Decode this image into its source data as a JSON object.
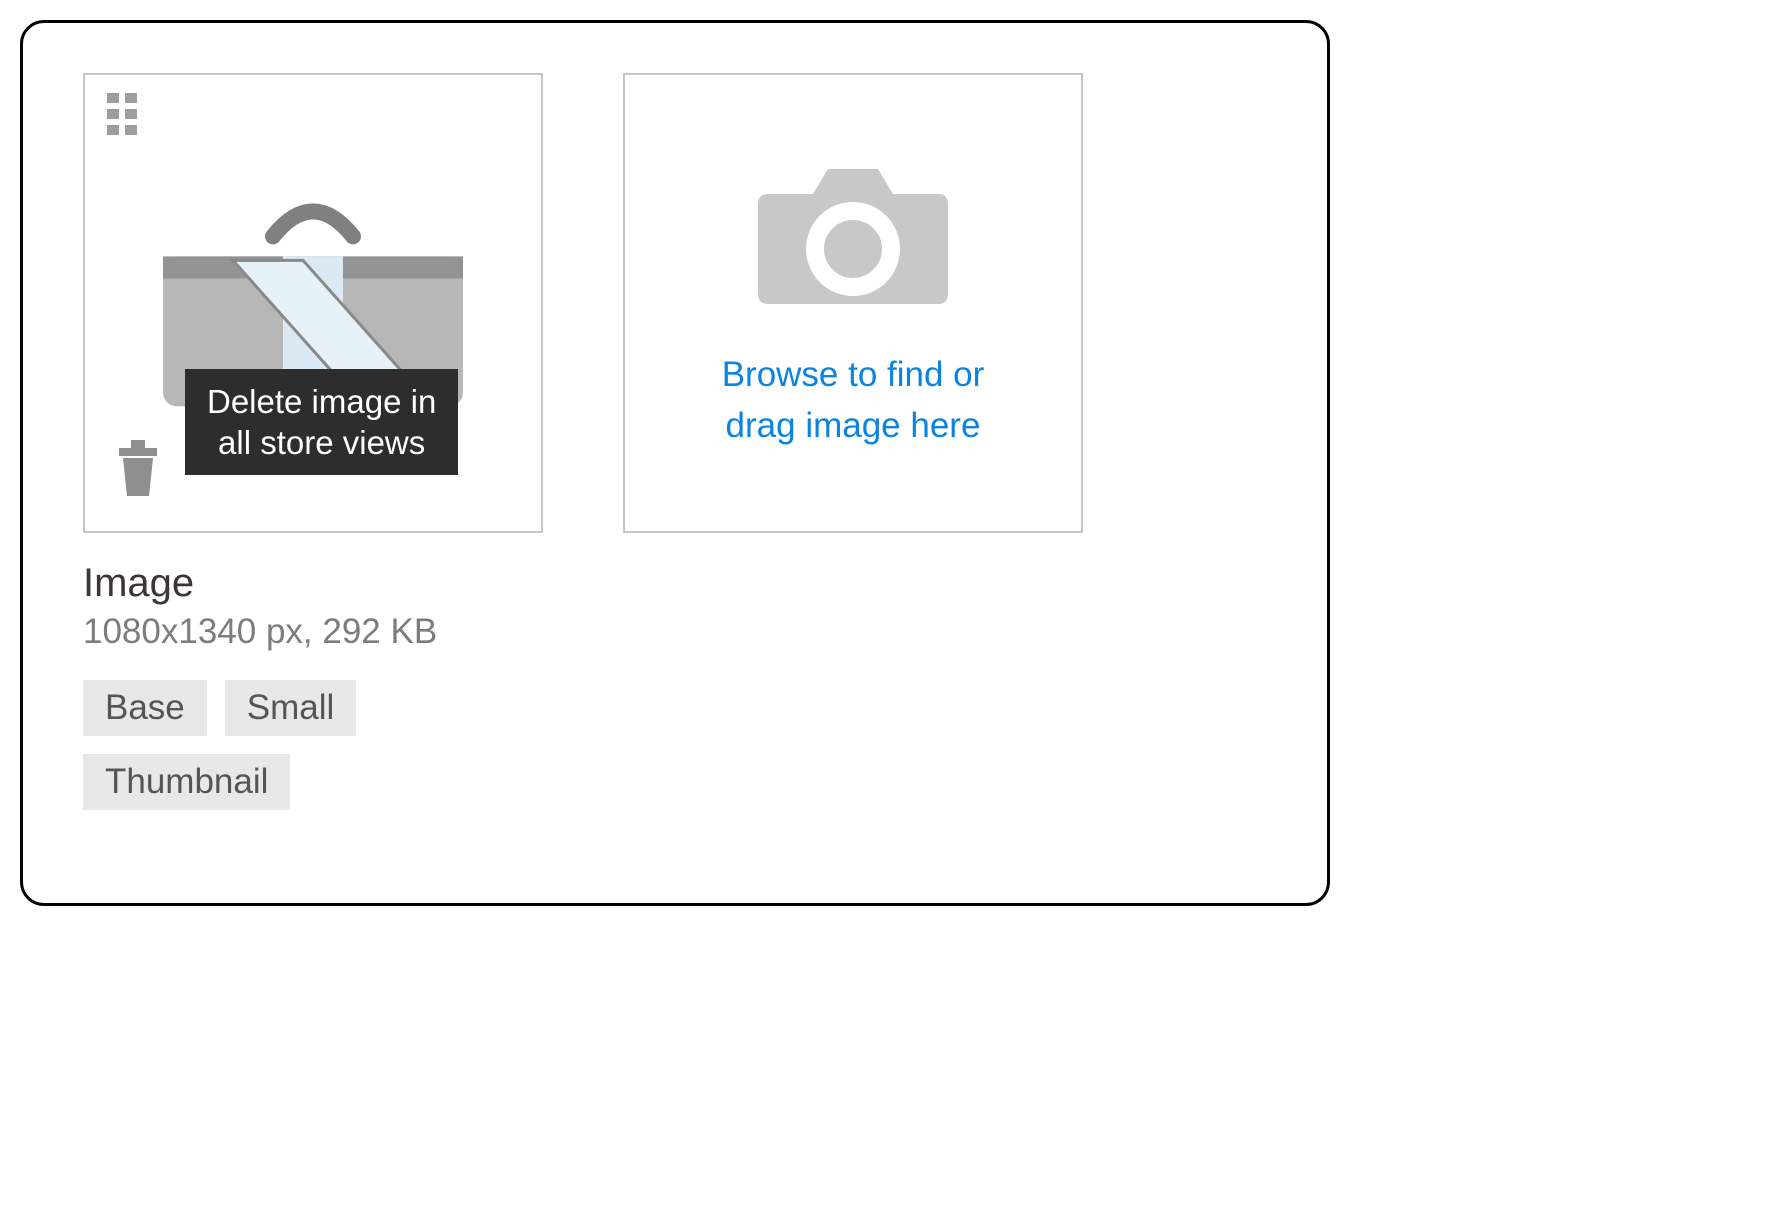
{
  "tooltip": "Delete image in\nall store views",
  "upload_prompt": "Browse to find or\ndrag image here",
  "info": {
    "label": "Image",
    "dimensions": "1080x1340 px, 292 KB"
  },
  "roles": [
    "Base",
    "Small",
    "Thumbnail"
  ]
}
